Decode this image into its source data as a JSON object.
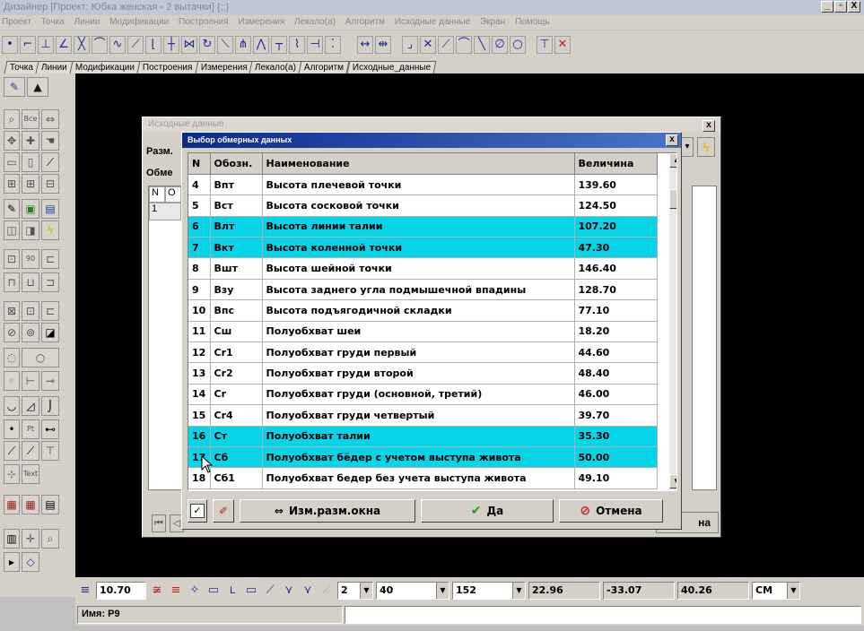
{
  "window": {
    "title": "Дизайнер [Проект: Юбка женская - 2 вытачки]  {;;}",
    "min": "_",
    "max": "▫",
    "close": "X"
  },
  "menu": [
    "Проект",
    "Точка",
    "Линии",
    "Модификации",
    "Построения",
    "Измерения",
    "Лекало(а)",
    "Алгоритм",
    "Исходные данные",
    "Экран",
    "Помощь"
  ],
  "tabs": [
    "Точка",
    "Линии",
    "Модификации",
    "Построения",
    "Измерения",
    "Лекало(а)",
    "Алгоритм",
    "Исходные_данные"
  ],
  "bg_dialog": {
    "title": "Исходные данные",
    "label_size": "Разм.",
    "label_obm": "Обме",
    "grid_head": [
      "N",
      "О"
    ],
    "grid_row": "1",
    "ok_partial": "на"
  },
  "dialog": {
    "title": "Выбор обмерных данных",
    "close": "x",
    "columns": [
      "N",
      "Обозн.",
      "Наименование",
      "Величина"
    ],
    "rows": [
      {
        "n": "4",
        "code": "Впт",
        "name": "Высота плечевой точки",
        "value": "139.60",
        "hl": false
      },
      {
        "n": "5",
        "code": "Вст",
        "name": "Высота сосковой точки",
        "value": "124.50",
        "hl": false
      },
      {
        "n": "6",
        "code": "Влт",
        "name": "Высота линии талии",
        "value": "107.20",
        "hl": true
      },
      {
        "n": "7",
        "code": "Вкт",
        "name": "Высота коленной точки",
        "value": "47.30",
        "hl": true
      },
      {
        "n": "8",
        "code": "Вшт",
        "name": "Высота шейной точки",
        "value": "146.40",
        "hl": false
      },
      {
        "n": "9",
        "code": "Взу",
        "name": "Высота заднего угла подмышечной впадины",
        "value": "128.70",
        "hl": false
      },
      {
        "n": "10",
        "code": "Впс",
        "name": "Высота подъягодичной складки",
        "value": "77.10",
        "hl": false
      },
      {
        "n": "11",
        "code": "Сш",
        "name": "Полуобхват шеи",
        "value": "18.20",
        "hl": false
      },
      {
        "n": "12",
        "code": "Cr1",
        "name": "Полуобхват груди первый",
        "value": "44.60",
        "hl": false
      },
      {
        "n": "13",
        "code": "Cr2",
        "name": "Полуобхват груди второй",
        "value": "48.40",
        "hl": false
      },
      {
        "n": "14",
        "code": "Cr",
        "name": "Полуобхват груди (основной, третий)",
        "value": "46.00",
        "hl": false
      },
      {
        "n": "15",
        "code": "Cr4",
        "name": "Полуобхват груди четвертый",
        "value": "39.70",
        "hl": false
      },
      {
        "n": "16",
        "code": "Ст",
        "name": "Полуобхват талии",
        "value": "35.30",
        "hl": true
      },
      {
        "n": "17",
        "code": "Сб",
        "name": "Полуобхват бёдер с учетом выступа живота",
        "value": "50.00",
        "hl": true
      },
      {
        "n": "18",
        "code": "Сб1",
        "name": "Полуобхват бедер без учета выступа живота",
        "value": "49.10",
        "hl": false
      }
    ],
    "check_mark": "✓",
    "btn_resize": "Изм.разм.окна",
    "btn_ok": "Да",
    "btn_cancel": "Отмена"
  },
  "status": {
    "value1": "10.70",
    "dd1": "2",
    "dd2": "40",
    "dd3": "152",
    "x": "22.96",
    "y": "-33.07",
    "len": "40.26",
    "unit": "СМ",
    "name_label": "Имя: P9"
  },
  "colors": {
    "highlight": "#08d4e8",
    "canvas": "#000000",
    "title_active": "#0c2a8c"
  }
}
